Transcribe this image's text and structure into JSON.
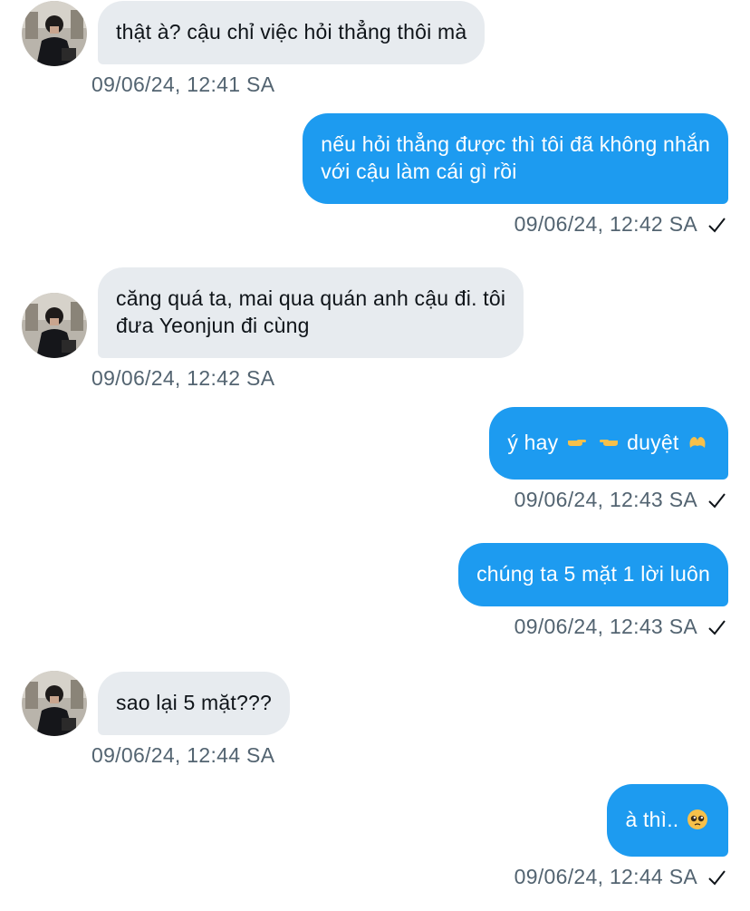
{
  "messages": [
    {
      "side": "in",
      "lines": [
        "thật à? cậu chỉ việc hỏi thẳng thôi mà"
      ],
      "time": "09/06/24, 12:41 SA"
    },
    {
      "side": "out",
      "lines": [
        "nếu hỏi thẳng được thì tôi đã không nhắn",
        "với cậu làm cái gì rồi"
      ],
      "time": "09/06/24, 12:42 SA"
    },
    {
      "side": "in",
      "lines": [
        "căng quá ta, mai qua quán anh cậu đi. tôi",
        "đưa Yeonjun đi cùng"
      ],
      "time": "09/06/24, 12:42 SA"
    },
    {
      "side": "out",
      "text_a": "ý hay",
      "text_b": "duyệt",
      "emojis": [
        "pointing-right-emoji",
        "leftwards-hand-emoji",
        "heart-hands-emoji"
      ],
      "time": "09/06/24, 12:43 SA"
    },
    {
      "side": "out",
      "lines": [
        "chúng ta 5 mặt 1 lời luôn"
      ],
      "time": "09/06/24, 12:43 SA"
    },
    {
      "side": "in",
      "lines": [
        "sao lại 5 mặt???"
      ],
      "time": "09/06/24, 12:44 SA"
    },
    {
      "side": "out",
      "text_a": "à thì..",
      "emojis": [
        "pleading-face-emoji"
      ],
      "time": "09/06/24, 12:44 SA"
    }
  ],
  "colors": {
    "incoming_bubble": "#e7ebef",
    "outgoing_bubble": "#1d9bf0",
    "timestamp": "#536471"
  }
}
